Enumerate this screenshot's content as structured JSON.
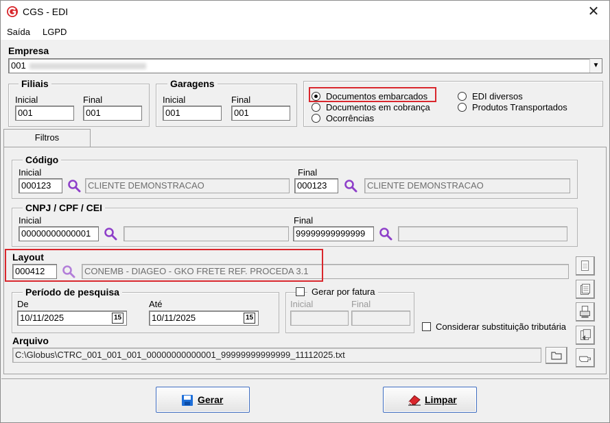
{
  "window": {
    "title": "CGS - EDI",
    "close_glyph": "✕"
  },
  "menu": {
    "items": [
      "Saída",
      "LGPD"
    ]
  },
  "empresa": {
    "label": "Empresa",
    "value": "001"
  },
  "filiais": {
    "title": "Filiais",
    "inicial_label": "Inicial",
    "final_label": "Final",
    "inicial": "001",
    "final": "001"
  },
  "garagens": {
    "title": "Garagens",
    "inicial_label": "Inicial",
    "final_label": "Final",
    "inicial": "001",
    "final": "001"
  },
  "doc_types": {
    "options": [
      "Documentos embarcados",
      "Documentos em cobrança",
      "Ocorrências",
      "EDI diversos",
      "Produtos Transportados"
    ],
    "selected": "Documentos embarcados"
  },
  "tabs": {
    "filtros": "Filtros"
  },
  "codigo": {
    "title": "Código",
    "inicial_label": "Inicial",
    "final_label": "Final",
    "inicial": "000123",
    "inicial_name": "CLIENTE DEMONSTRACAO",
    "final": "000123",
    "final_name": "CLIENTE DEMONSTRACAO"
  },
  "cnpj": {
    "title": "CNPJ / CPF / CEI",
    "inicial_label": "Inicial",
    "final_label": "Final",
    "inicial": "00000000000001",
    "final": "99999999999999"
  },
  "layout": {
    "title": "Layout",
    "code": "000412",
    "description": "CONEMB - DIAGEO - GKO FRETE REF. PROCEDA 3.1"
  },
  "periodo": {
    "title": "Período de pesquisa",
    "de_label": "De",
    "ate_label": "Até",
    "de": "10/11/2025",
    "ate": "10/11/2025",
    "cal_glyph": "15"
  },
  "fatura": {
    "label": "Gerar por fatura",
    "inicial_label": "Inicial",
    "final_label": "Final"
  },
  "substituicao": {
    "label": "Considerar substituição tributária"
  },
  "arquivo": {
    "label": "Arquivo",
    "path": "C:\\Globus\\CTRC_001_001_001_00000000000001_99999999999999_11112025.txt"
  },
  "buttons": {
    "gerar": "Gerar",
    "limpar": "Limpar"
  },
  "colors": {
    "highlight": "#d9262c",
    "search": "#8e3fc9",
    "logo": "#d7262b"
  }
}
